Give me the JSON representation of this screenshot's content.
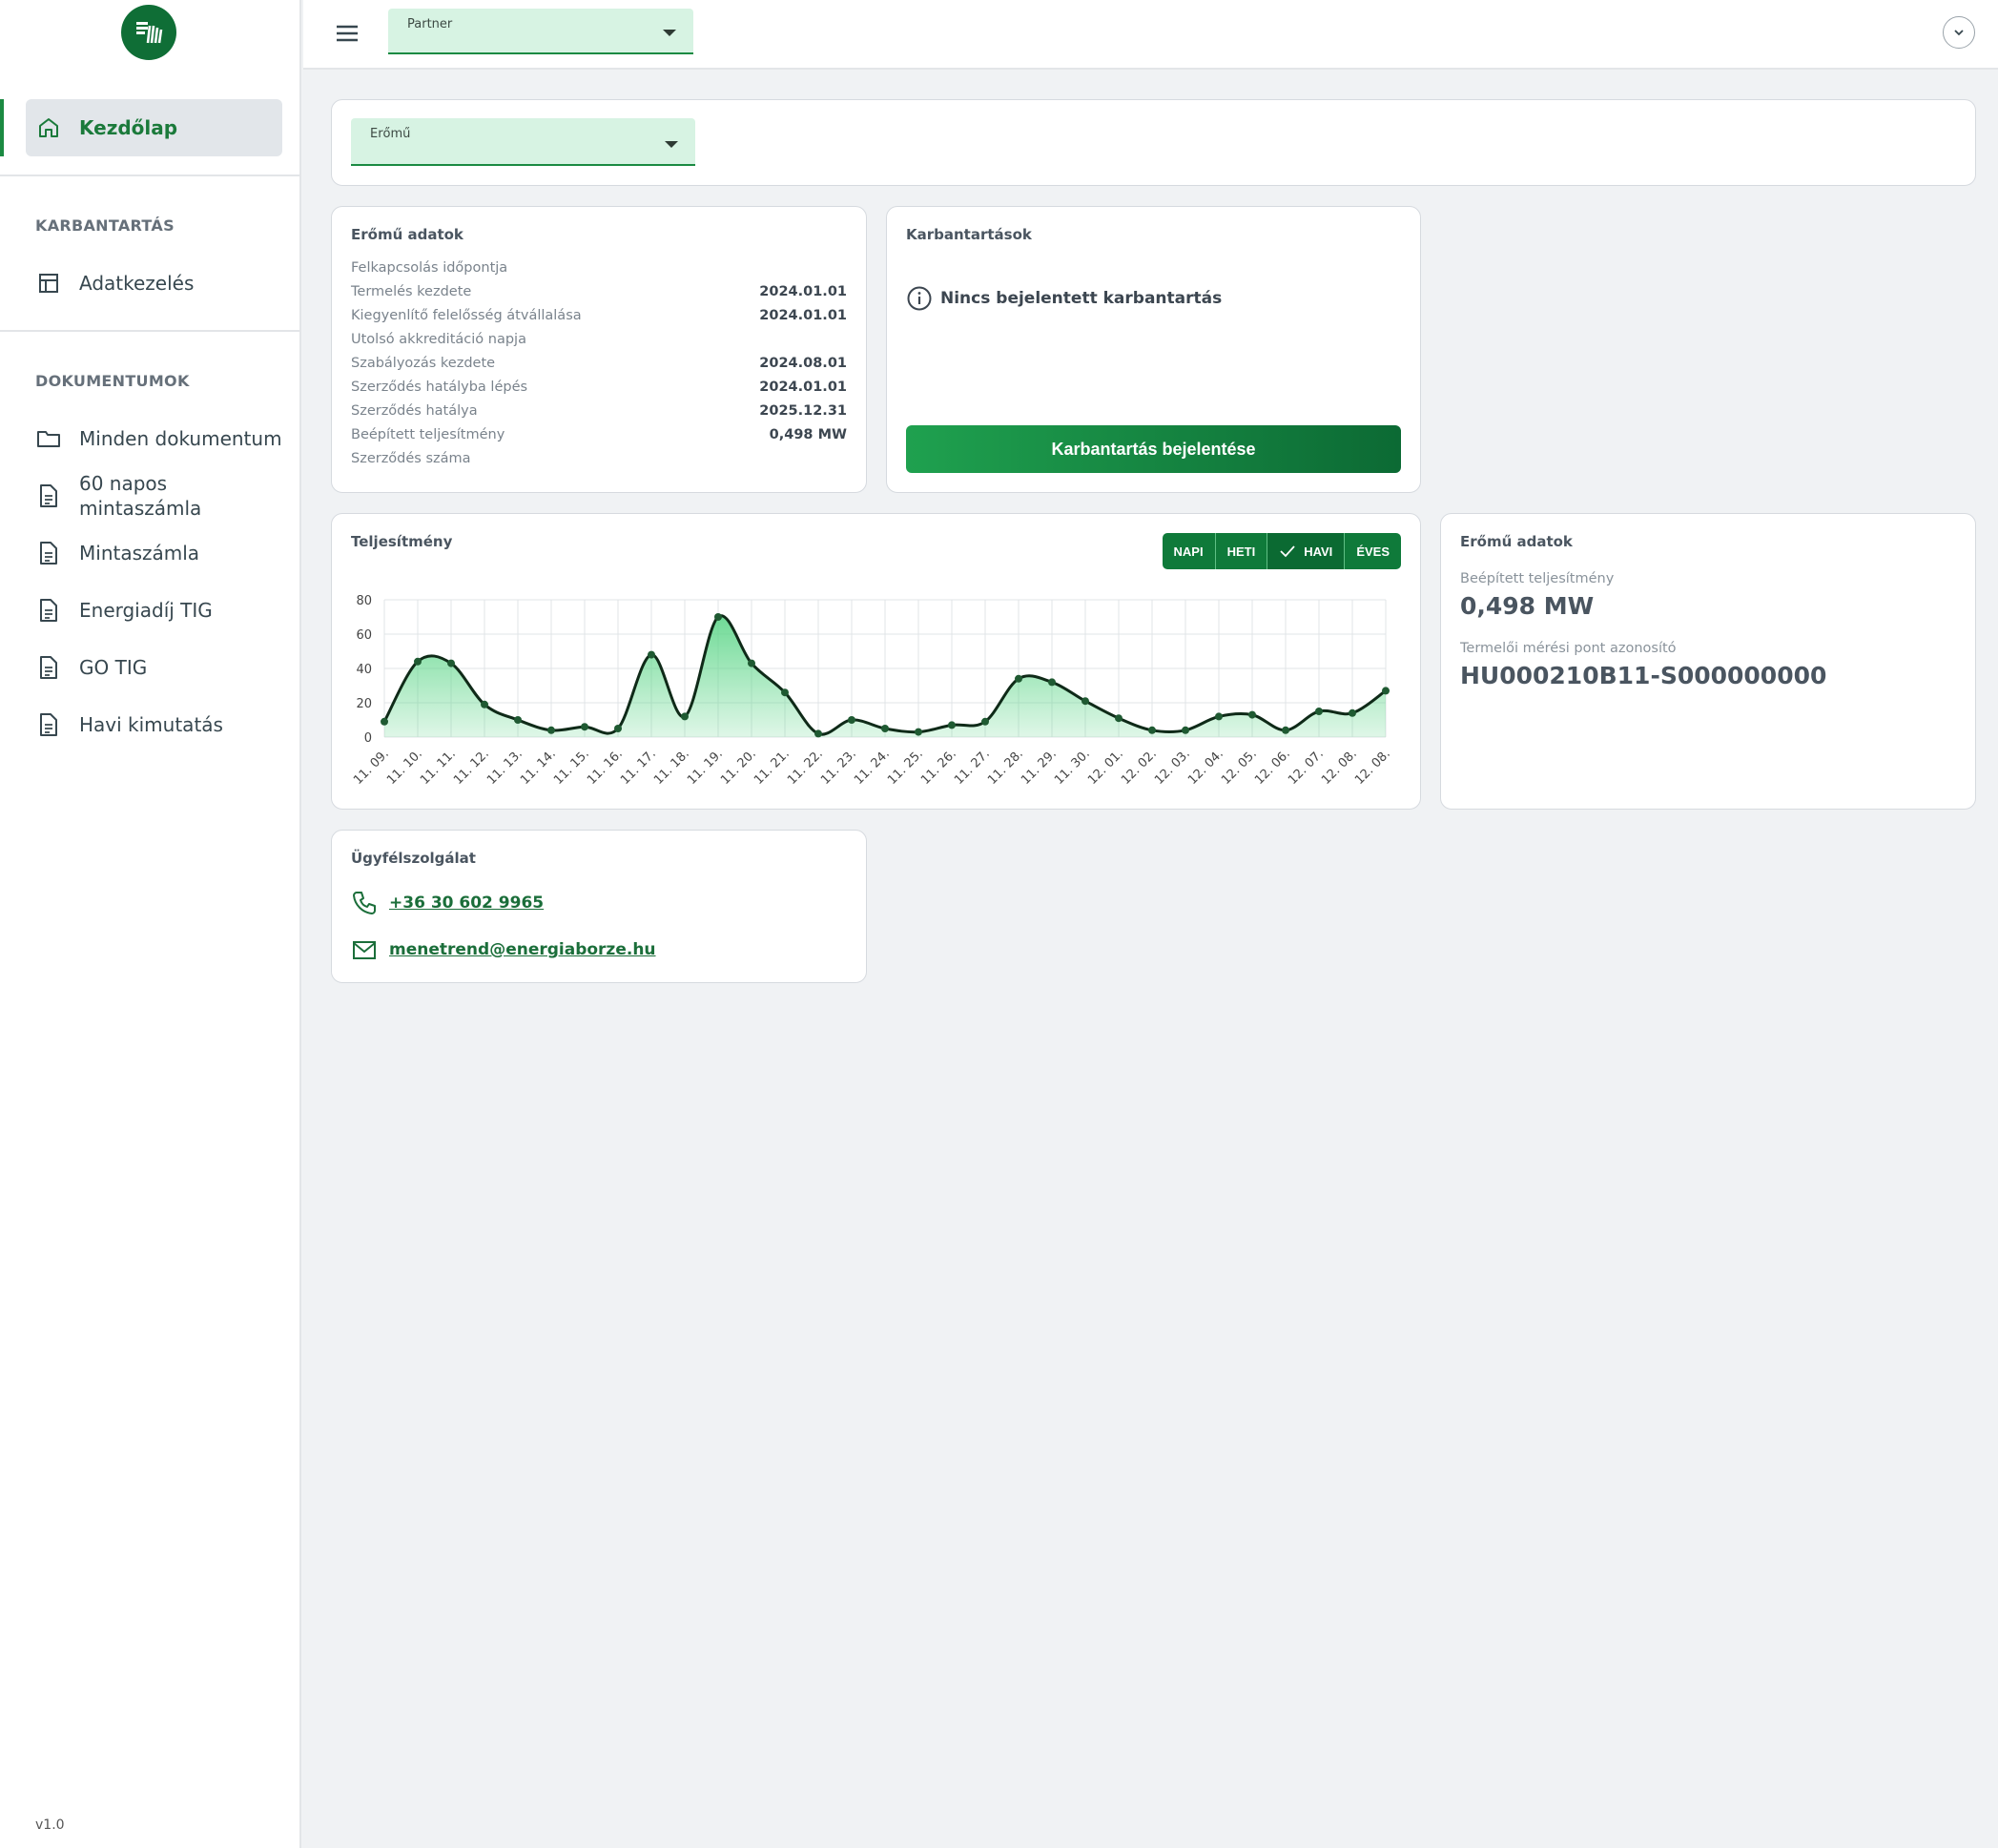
{
  "sidebar": {
    "home_label": "Kezdőlap",
    "sections": [
      {
        "title": "KARBANTARTÁS",
        "items": [
          {
            "label": "Adatkezelés",
            "icon": "table-icon"
          }
        ]
      },
      {
        "title": "DOKUMENTUMOK",
        "items": [
          {
            "label": "Minden dokumentum",
            "icon": "folder-icon"
          },
          {
            "label": "60 napos mintaszámla",
            "icon": "document-icon"
          },
          {
            "label": "Mintaszámla",
            "icon": "document-icon"
          },
          {
            "label": "Energiadíj TIG",
            "icon": "document-icon"
          },
          {
            "label": "GO TIG",
            "icon": "document-icon"
          },
          {
            "label": "Havi kimutatás",
            "icon": "document-icon"
          }
        ]
      }
    ],
    "version": "v1.0"
  },
  "topbar": {
    "partner_label": "Partner"
  },
  "filter": {
    "eromu_label": "Erőmű"
  },
  "plant_data": {
    "title": "Erőmű adatok",
    "rows": [
      {
        "key": "Felkapcsolás időpontja",
        "value": ""
      },
      {
        "key": "Termelés kezdete",
        "value": "2024.01.01"
      },
      {
        "key": "Kiegyenlítő felelősség átvállalása",
        "value": "2024.01.01"
      },
      {
        "key": "Utolsó akkreditáció napja",
        "value": ""
      },
      {
        "key": "Szabályozás kezdete",
        "value": "2024.08.01"
      },
      {
        "key": "Szerződés hatályba lépés",
        "value": "2024.01.01"
      },
      {
        "key": "Szerződés hatálya",
        "value": "2025.12.31"
      },
      {
        "key": "Beépített teljesítmény",
        "value": "0,498 MW"
      },
      {
        "key": "Szerződés száma",
        "value": ""
      }
    ]
  },
  "maintenance": {
    "title": "Karbantartások",
    "empty_text": "Nincs bejelentett karbantartás",
    "button_label": "Karbantartás bejelentése"
  },
  "performance": {
    "title": "Teljesítmény",
    "toggles": [
      {
        "label": "NAPI",
        "selected": false
      },
      {
        "label": "HETI",
        "selected": false
      },
      {
        "label": "HAVI",
        "selected": true
      },
      {
        "label": "ÉVES",
        "selected": false
      }
    ]
  },
  "chart_data": {
    "type": "area",
    "title": "",
    "xlabel": "",
    "ylabel": "",
    "ylim": [
      0,
      80
    ],
    "yticks": [
      0,
      20,
      40,
      60,
      80
    ],
    "grid": true,
    "colors": {
      "line": "#0f2a18",
      "fill": "#5fd68a",
      "point": "#1f5a32"
    },
    "x": [
      "11. 09.",
      "11. 10.",
      "11. 11.",
      "11. 12.",
      "11. 13.",
      "11. 14.",
      "11. 15.",
      "11. 16.",
      "11. 17.",
      "11. 18.",
      "11. 19.",
      "11. 20.",
      "11. 21.",
      "11. 22.",
      "11. 23.",
      "11. 24.",
      "11. 25.",
      "11. 26.",
      "11. 27.",
      "11. 28.",
      "11. 29.",
      "11. 30.",
      "12. 01.",
      "12. 02.",
      "12. 03.",
      "12. 04.",
      "12. 05.",
      "12. 06.",
      "12. 07.",
      "12. 08.",
      "12. 08."
    ],
    "values": [
      9,
      44,
      43,
      19,
      10,
      4,
      6,
      5,
      48,
      12,
      70,
      43,
      26,
      2,
      10,
      5,
      3,
      7,
      9,
      34,
      32,
      21,
      11,
      4,
      4,
      12,
      13,
      4,
      15,
      14,
      27
    ]
  },
  "plant_summary": {
    "title": "Erőmű adatok",
    "capacity_label": "Beépített teljesítmény",
    "capacity_value": "0,498 MW",
    "meter_label": "Termelői mérési pont azonosító",
    "meter_value": "HU000210B11-S000000000"
  },
  "support": {
    "title": "Ügyfélszolgálat",
    "phone": "+36 30 602 9965",
    "email": "menetrend@energiaborze.hu"
  },
  "colors": {
    "brand": "#0f6e36",
    "accent": "#1b8a42",
    "select_bg": "#d7f3e3"
  }
}
